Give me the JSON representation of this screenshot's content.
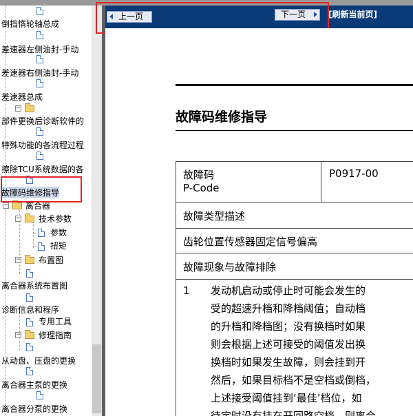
{
  "tree": {
    "items": [
      {
        "label": "倒挡惰轮轴总成"
      },
      {
        "label": "差速器左侧油封-手动"
      },
      {
        "label": "差速器右侧油封-手动"
      },
      {
        "label": "差速器总成"
      },
      {
        "label": "部件更换后诊断软件的"
      },
      {
        "label": "特殊功能的各流程过程"
      },
      {
        "label": "擦除TCU系统数据的各"
      },
      {
        "label": "故障码维修指导"
      },
      {
        "label": "离合器"
      },
      {
        "label": "技术参数"
      },
      {
        "label": "参数"
      },
      {
        "label": "扭矩"
      },
      {
        "label": "布置图"
      },
      {
        "label": "离合器系统布置图"
      },
      {
        "label": "诊断信息和程序"
      },
      {
        "label": "专用工具"
      },
      {
        "label": "修理指南"
      },
      {
        "label": "从动盘、压盘的更换"
      },
      {
        "label": "离合器主泵的更换"
      },
      {
        "label": "离合器分泵的更换"
      }
    ]
  },
  "nav": {
    "prev_label": "上一页",
    "next_label": "下一页",
    "refresh_label": "[刷新当前页]"
  },
  "doc": {
    "title": "故障码维修指导",
    "table": {
      "code_header_line1": "故障码",
      "code_header_line2": "P-Code",
      "code_value": "P0917-00",
      "type_header": "故障类型描述",
      "type_value": "齿轮位置传感器固定信号偏高",
      "symptom_header": "故障现象与故障排除",
      "step_number": "1",
      "step_lines": [
        "发动机启动或停止时可能会发生的",
        "受的超速升档和降档阈值；自动档",
        "的升档和降档图；没有换档时如果",
        "则会根据上述可接受的阈值发出换",
        "换档时如果发生故障，则会挂到开",
        "然后，如果目标档不是空档或倒档，",
        "上述接受阈值挂到‘最佳’档位，如",
        "待定时没有挂在开回路空档，则离合"
      ]
    }
  },
  "colors": {
    "nav_bg": "#0a3b78",
    "highlight_red": "#e0262b",
    "selected_bg": "#cfd8ec"
  }
}
